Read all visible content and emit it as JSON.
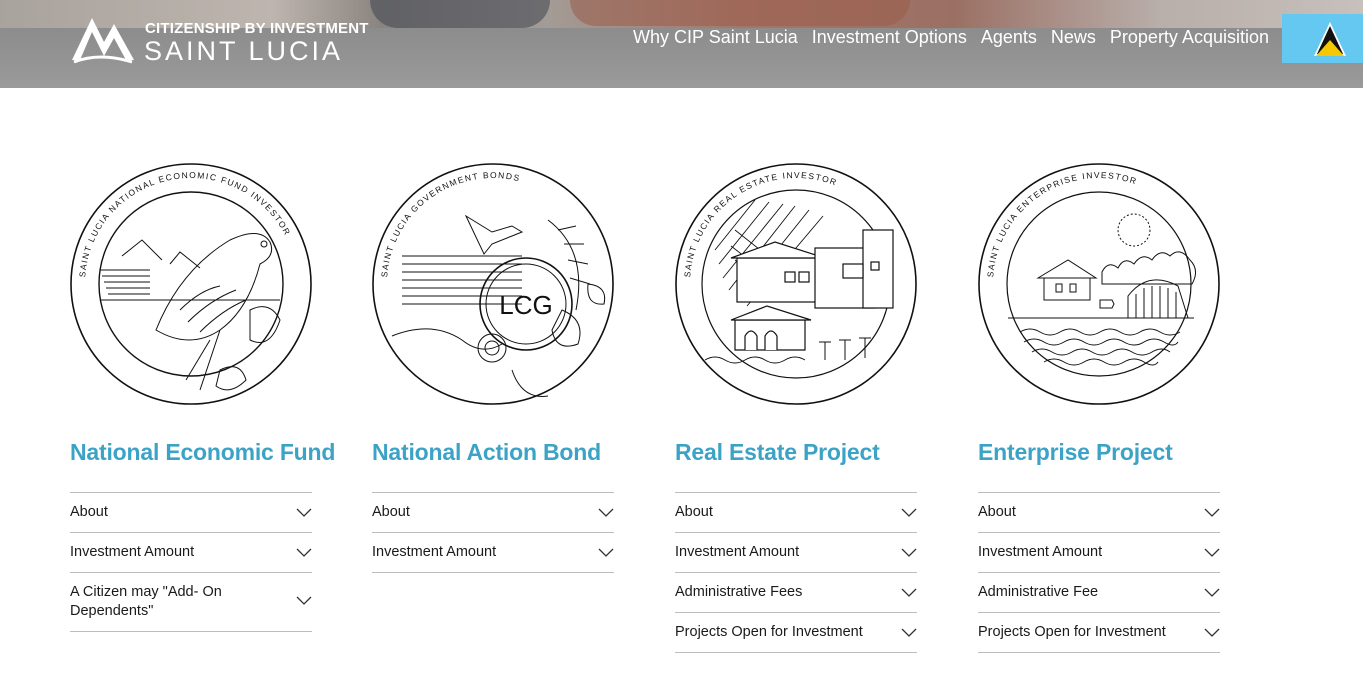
{
  "header": {
    "logo": {
      "line1": "CITIZENSHIP BY INVESTMENT",
      "line2": "SAINT LUCIA"
    },
    "nav": [
      "Why CIP Saint Lucia",
      "Investment Options",
      "Agents",
      "News",
      "Property Acquisition"
    ],
    "flag_icon": "saint-lucia-flag-icon"
  },
  "colors": {
    "heading": "#3da3c6",
    "flag_bg": "#65c8f0",
    "header_bg": "#8c8c8c"
  },
  "options": [
    {
      "title": "National Economic Fund",
      "emblem_text": "SAINT LUCIA NATIONAL ECONOMIC FUND INVESTOR",
      "emblem_icon": "parrot-emblem-icon",
      "items": [
        "About",
        "Investment Amount",
        "A Citizen may \"Add- On Dependents\""
      ]
    },
    {
      "title": "National Action Bond",
      "emblem_text": "SAINT LUCIA GOVERNMENT BONDS",
      "emblem_center": "LCG",
      "emblem_icon": "hummingbird-emblem-icon",
      "items": [
        "About",
        "Investment Amount"
      ]
    },
    {
      "title": "Real Estate Project",
      "emblem_text": "SAINT LUCIA REAL ESTATE INVESTOR",
      "emblem_icon": "villa-emblem-icon",
      "items": [
        "About",
        "Investment Amount",
        "Administrative Fees",
        "Projects Open for Investment"
      ]
    },
    {
      "title": "Enterprise Project",
      "emblem_text": "SAINT LUCIA ENTERPRISE INVESTOR",
      "emblem_icon": "enterprise-emblem-icon",
      "items": [
        "About",
        "Investment Amount",
        "Administrative Fee",
        "Projects Open for Investment"
      ]
    }
  ]
}
